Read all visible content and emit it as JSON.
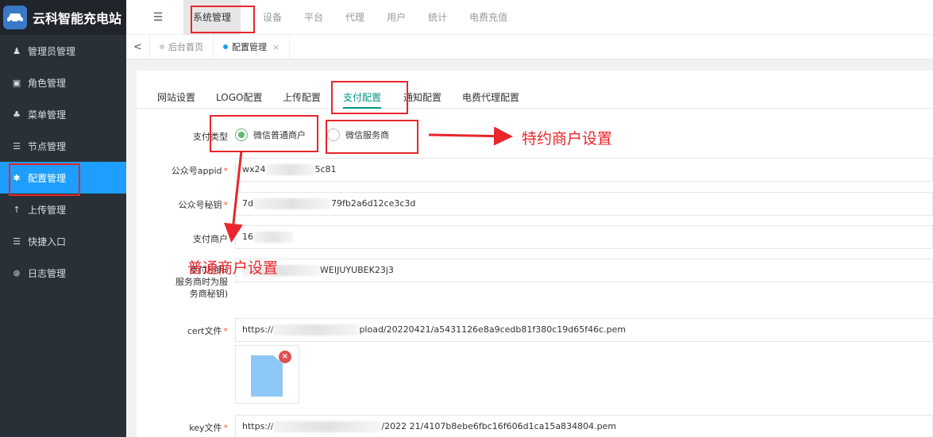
{
  "brand": {
    "title": "云科智能充电站",
    "logo_icon": "car-icon"
  },
  "sidebar": {
    "items": [
      {
        "label": "管理员管理",
        "icon": "user-icon",
        "glyph": "♟"
      },
      {
        "label": "角色管理",
        "icon": "role-icon",
        "glyph": "▣"
      },
      {
        "label": "菜单管理",
        "icon": "tree-icon",
        "glyph": "♣"
      },
      {
        "label": "节点管理",
        "icon": "list-icon",
        "glyph": "☰"
      },
      {
        "label": "配置管理",
        "icon": "gear-icon",
        "glyph": "✱",
        "active": true
      },
      {
        "label": "上传管理",
        "icon": "upload-icon",
        "glyph": "↑"
      },
      {
        "label": "快捷入口",
        "icon": "list-icon",
        "glyph": "☰"
      },
      {
        "label": "日志管理",
        "icon": "log-icon",
        "glyph": "⊛"
      }
    ]
  },
  "topnav": {
    "menu_icon": "☰",
    "items": [
      "系统管理",
      "设备",
      "平台",
      "代理",
      "用户",
      "统计",
      "电费充值"
    ]
  },
  "tabs": {
    "back": "<",
    "home": "后台首页",
    "current": "配置管理",
    "close": "×"
  },
  "subtabs": [
    "网站设置",
    "LOGO配置",
    "上传配置",
    "支付配置",
    "通知配置",
    "电费代理配置"
  ],
  "form": {
    "pay_type_label": "支付类型",
    "pay_type_options": [
      "微信普通商户",
      "微信服务商"
    ],
    "appid_label": "公众号appid",
    "appid_prefix": "wx24",
    "appid_suffix": "5c81",
    "secret_label": "公众号秘钥",
    "secret_prefix": "7d",
    "secret_suffix": "79fb2a6d12ce3c3d",
    "mch_label": "支付商户",
    "mch_prefix": "16",
    "key_label_line1": "支付秘钥(",
    "key_label_line2": "服务商时为服",
    "key_label_line3": "务商秘钥)",
    "key_suffix": "WEIJUYUBEK23j3",
    "cert_label": "cert文件",
    "cert_prefix": "https://",
    "cert_suffix": "pload/20220421/a5431126e8a9cedb81f380c19d65f46c.pem",
    "file_delete": "×",
    "keyfile_label": "key文件",
    "keyfile_prefix": "https://",
    "keyfile_suffix": "/2022  21/4107b8ebe6fbc16f606d1ca15a834804.pem",
    "required_mark": "*"
  },
  "annotations": {
    "special_merchant": "特约商户设置",
    "normal_merchant": "普通商户设置"
  },
  "colors": {
    "sidebar_bg": "#2a3038",
    "active_blue": "#1e9fff",
    "tab_green": "#009688",
    "radio_green": "#5fb878",
    "annotation_red": "#e8262b"
  }
}
